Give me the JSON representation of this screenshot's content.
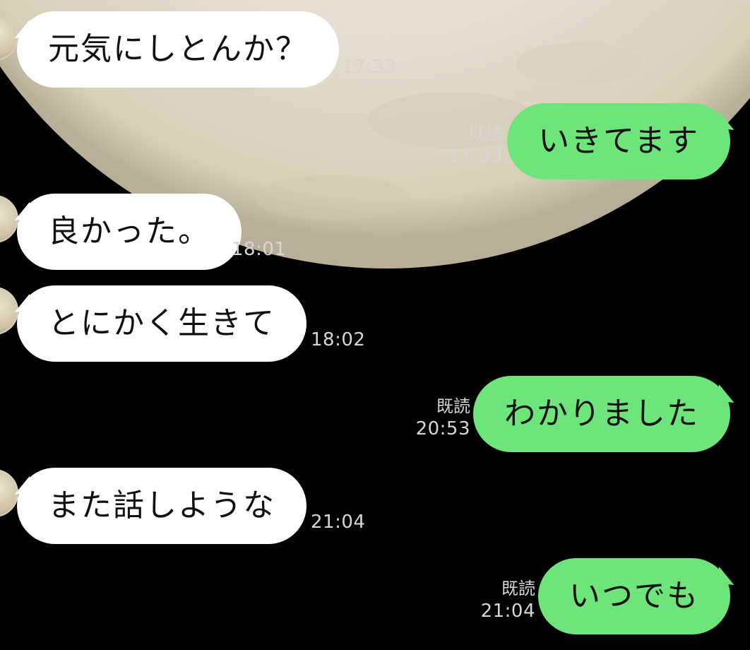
{
  "colors": {
    "background": "#000000",
    "incoming_bubble": "#ffffff",
    "outgoing_bubble": "#6de57a",
    "meta_text": "#d6d6d6"
  },
  "messages": [
    {
      "direction": "in",
      "text": "元気にしとんか？",
      "time": "17:33"
    },
    {
      "direction": "out",
      "text": "いきてます",
      "read": "既読",
      "time": "17:33"
    },
    {
      "direction": "in",
      "text": "良かった。",
      "time": "18:01"
    },
    {
      "direction": "in",
      "text": "とにかく生きて",
      "time": "18:02"
    },
    {
      "direction": "out",
      "text": "わかりました",
      "read": "既読",
      "time": "20:53"
    },
    {
      "direction": "in",
      "text": "また話しような",
      "time": "21:04"
    },
    {
      "direction": "out",
      "text": "いつでも",
      "read": "既読",
      "time": "21:04"
    }
  ]
}
